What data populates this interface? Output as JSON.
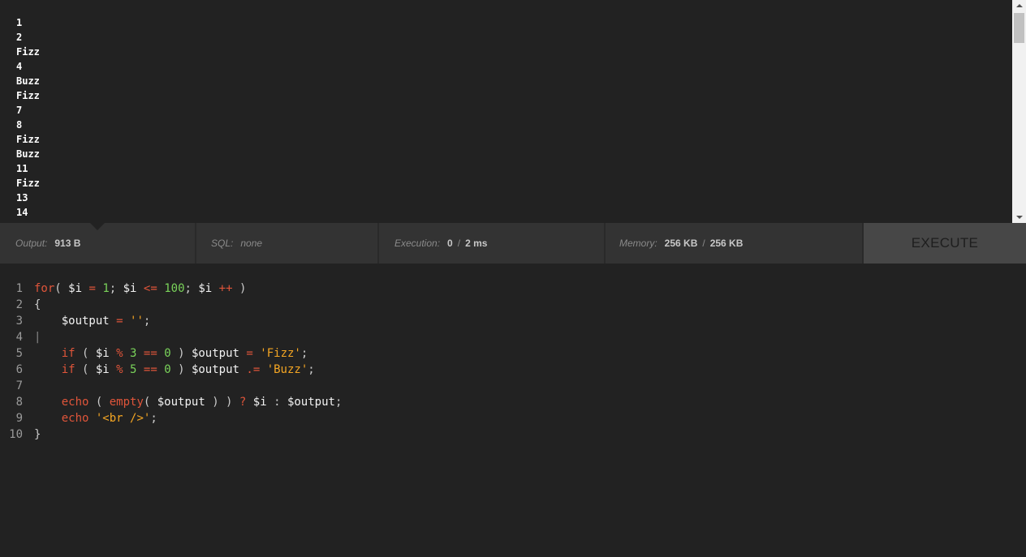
{
  "output": {
    "lines": [
      "1",
      "2",
      "Fizz",
      "4",
      "Buzz",
      "Fizz",
      "7",
      "8",
      "Fizz",
      "Buzz",
      "11",
      "Fizz",
      "13",
      "14"
    ]
  },
  "status": {
    "output_label": "Output:",
    "output_value": "913 B",
    "sql_label": "SQL:",
    "sql_value": "none",
    "exec_label": "Execution:",
    "exec_value_1": "0",
    "exec_sep": "/",
    "exec_value_2": "2 ms",
    "mem_label": "Memory:",
    "mem_value_1": "256 KB",
    "mem_sep": "/",
    "mem_value_2": "256 KB"
  },
  "execute": {
    "label": "EXECUTE"
  },
  "code": {
    "line_numbers": [
      "1",
      "2",
      "3",
      "4",
      "5",
      "6",
      "7",
      "8",
      "9",
      "10"
    ],
    "lines": [
      [
        [
          "kw",
          "for"
        ],
        [
          "pun",
          "( "
        ],
        [
          "var",
          "$i"
        ],
        [
          "pun",
          " "
        ],
        [
          "op",
          "="
        ],
        [
          "pun",
          " "
        ],
        [
          "num",
          "1"
        ],
        [
          "pun",
          "; "
        ],
        [
          "var",
          "$i"
        ],
        [
          "pun",
          " "
        ],
        [
          "op",
          "<="
        ],
        [
          "pun",
          " "
        ],
        [
          "num",
          "100"
        ],
        [
          "pun",
          "; "
        ],
        [
          "var",
          "$i"
        ],
        [
          "pun",
          " "
        ],
        [
          "op",
          "++"
        ],
        [
          "pun",
          " )"
        ]
      ],
      [
        [
          "pun",
          "{"
        ]
      ],
      [
        [
          "pun",
          "    "
        ],
        [
          "var",
          "$output"
        ],
        [
          "pun",
          " "
        ],
        [
          "op",
          "="
        ],
        [
          "pun",
          " "
        ],
        [
          "str",
          "''"
        ],
        [
          "pun",
          ";"
        ]
      ],
      [
        [
          "cursor",
          "|"
        ]
      ],
      [
        [
          "pun",
          "    "
        ],
        [
          "kw",
          "if"
        ],
        [
          "pun",
          " ( "
        ],
        [
          "var",
          "$i"
        ],
        [
          "pun",
          " "
        ],
        [
          "op",
          "%"
        ],
        [
          "pun",
          " "
        ],
        [
          "num",
          "3"
        ],
        [
          "pun",
          " "
        ],
        [
          "op",
          "=="
        ],
        [
          "pun",
          " "
        ],
        [
          "num",
          "0"
        ],
        [
          "pun",
          " ) "
        ],
        [
          "var",
          "$output"
        ],
        [
          "pun",
          " "
        ],
        [
          "op",
          "="
        ],
        [
          "pun",
          " "
        ],
        [
          "str",
          "'Fizz'"
        ],
        [
          "pun",
          ";"
        ]
      ],
      [
        [
          "pun",
          "    "
        ],
        [
          "kw",
          "if"
        ],
        [
          "pun",
          " ( "
        ],
        [
          "var",
          "$i"
        ],
        [
          "pun",
          " "
        ],
        [
          "op",
          "%"
        ],
        [
          "pun",
          " "
        ],
        [
          "num",
          "5"
        ],
        [
          "pun",
          " "
        ],
        [
          "op",
          "=="
        ],
        [
          "pun",
          " "
        ],
        [
          "num",
          "0"
        ],
        [
          "pun",
          " ) "
        ],
        [
          "var",
          "$output"
        ],
        [
          "pun",
          " "
        ],
        [
          "op",
          ".="
        ],
        [
          "pun",
          " "
        ],
        [
          "str",
          "'Buzz'"
        ],
        [
          "pun",
          ";"
        ]
      ],
      [],
      [
        [
          "pun",
          "    "
        ],
        [
          "kw",
          "echo"
        ],
        [
          "pun",
          " ( "
        ],
        [
          "kw",
          "empty"
        ],
        [
          "pun",
          "( "
        ],
        [
          "var",
          "$output"
        ],
        [
          "pun",
          " ) ) "
        ],
        [
          "op",
          "?"
        ],
        [
          "pun",
          " "
        ],
        [
          "var",
          "$i"
        ],
        [
          "pun",
          " : "
        ],
        [
          "var",
          "$output"
        ],
        [
          "pun",
          ";"
        ]
      ],
      [
        [
          "pun",
          "    "
        ],
        [
          "kw",
          "echo"
        ],
        [
          "pun",
          " "
        ],
        [
          "str",
          "'<br />'"
        ],
        [
          "pun",
          ";"
        ]
      ],
      [
        [
          "pun",
          "}"
        ]
      ]
    ]
  }
}
